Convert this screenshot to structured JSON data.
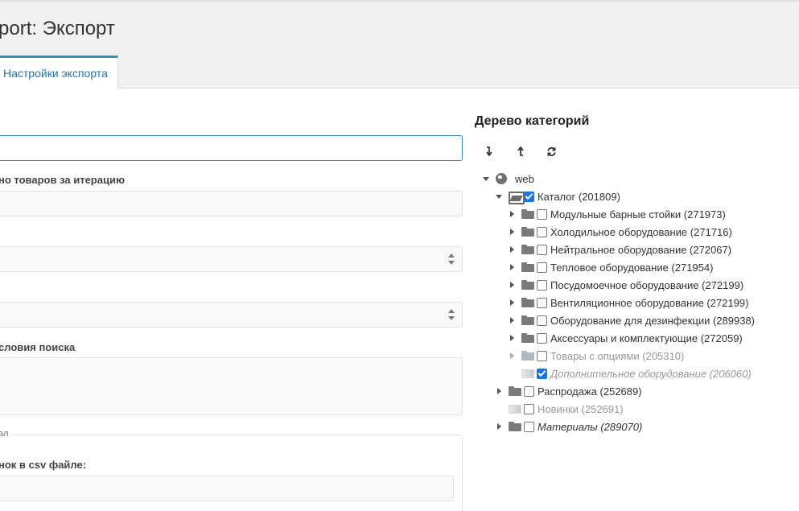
{
  "page": {
    "title": "port: Экспорт"
  },
  "tabs": [
    {
      "label": "Настройки экспорта"
    }
  ],
  "form": {
    "items_per_iteration_label": "но товаров за итерацию",
    "search_conditions_label": "словия поиска",
    "fieldset_legend": "ал",
    "csv_label": "нок в csv файле:"
  },
  "tree": {
    "title": "Дерево категорий",
    "toolbar": [
      {
        "name": "expand-all-button",
        "glyph": "↴"
      },
      {
        "name": "collapse-all-button",
        "glyph": "⮥"
      },
      {
        "name": "refresh-button",
        "glyph": "⟳"
      }
    ],
    "root": "web",
    "catalog": "Каталог (201809)",
    "children": [
      "Модульные барные стойки (271973)",
      "Холодильное оборудование (271716)",
      "Нейтральное оборудование (272067)",
      "Тепловое оборудование (271954)",
      "Посудомоечное оборудование (272199)",
      "Вентиляционное оборудование (272199)",
      "Оборудование для дезинфекции (289938)",
      "Аксессуары и комплектующие (272059)",
      "Товары с опциями (205310)",
      "Дополнительное оборудование (206060)"
    ],
    "top_level": [
      "Распродажа (252689)",
      "Новинки (252691)",
      "Материалы (289070)"
    ]
  },
  "colors": {
    "accent": "#3c8dbc",
    "checkbox": "#1a73e8"
  }
}
